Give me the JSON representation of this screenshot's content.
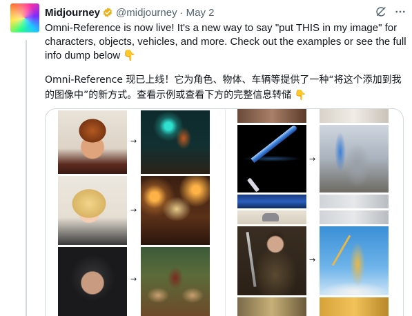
{
  "tweet": {
    "author_name": "Midjourney",
    "handle": "@midjourney",
    "separator": "·",
    "date": "May 2",
    "text_en": "Omni-Reference is now live! It's a new way to say \"put THIS in my image\" for characters, objects, vehicles, and more. Check out the examples or see the full info dump below 👇",
    "text_cn": "Omni-Reference 现已上线！它为角色、物体、车辆等提供了一种“将这个添加到我的图像中”的新方式。查看示例或查看下方的完整信息转储 👇"
  },
  "icons": {
    "verified": "verified-badge-icon",
    "grok": "grok-icon",
    "more": "more-options-icon",
    "arrow": "→"
  },
  "colors": {
    "verified_badge": "#e8b21c",
    "text_primary": "#0f1419",
    "text_secondary": "#536471",
    "border": "#cfd9de"
  }
}
